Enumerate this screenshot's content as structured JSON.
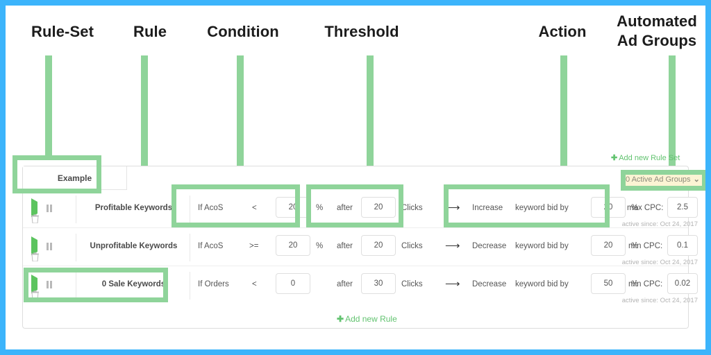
{
  "annotations": {
    "labels": [
      {
        "text": "Rule-Set"
      },
      {
        "text": "Rule"
      },
      {
        "text": "Condition"
      },
      {
        "text": "Threshold"
      },
      {
        "text": "Action"
      },
      {
        "text": "Automated Ad Groups"
      }
    ]
  },
  "panel": {
    "ruleset_tab_label": "Example",
    "add_new_ruleset_label": "Add new Rule Set",
    "add_new_ruleset_plus": "✚",
    "ad_groups_select_label": "0 Active Ad Groups",
    "ad_groups_caret": "⌄",
    "add_new_rule_label": "Add new Rule",
    "add_new_rule_plus": "✚",
    "icons": {
      "play": "play-icon",
      "pause": "pause-icon",
      "trash": "trash-icon"
    },
    "arrow_glyph": "⟶",
    "rows": [
      {
        "rule_name": "Profitable Keywords",
        "condition_prefix": "If AcoS",
        "operator": "<",
        "condition_value": "20",
        "condition_unit": "%",
        "threshold_prefix": "after",
        "threshold_value": "20",
        "threshold_unit": "Clicks",
        "action_verb": "Increase",
        "action_object": "keyword bid by",
        "action_value": "20",
        "action_unit": "%",
        "cpc_label": "max CPC:",
        "cpc_value": "2.5",
        "active_since": "active since: Oct 24, 2017"
      },
      {
        "rule_name": "Unprofitable Keywords",
        "condition_prefix": "If AcoS",
        "operator": ">=",
        "condition_value": "20",
        "condition_unit": "%",
        "threshold_prefix": "after",
        "threshold_value": "20",
        "threshold_unit": "Clicks",
        "action_verb": "Decrease",
        "action_object": "keyword bid by",
        "action_value": "20",
        "action_unit": "%",
        "cpc_label": "min CPC:",
        "cpc_value": "0.1",
        "active_since": "active since: Oct 24, 2017"
      },
      {
        "rule_name": "0 Sale Keywords",
        "condition_prefix": "If Orders",
        "operator": "<",
        "condition_value": "0",
        "condition_unit": "",
        "threshold_prefix": "after",
        "threshold_value": "30",
        "threshold_unit": "Clicks",
        "action_verb": "Decrease",
        "action_object": "keyword bid by",
        "action_value": "50",
        "action_unit": "%",
        "cpc_label": "min CPC:",
        "cpc_value": "0.02",
        "active_since": "active since: Oct 24, 2017"
      }
    ]
  },
  "colors": {
    "frame_blue": "#3cb4fb",
    "annotation_green": "#8fd49a",
    "link_green": "#62c370",
    "highlight_yellow": "#fcf4d4"
  }
}
